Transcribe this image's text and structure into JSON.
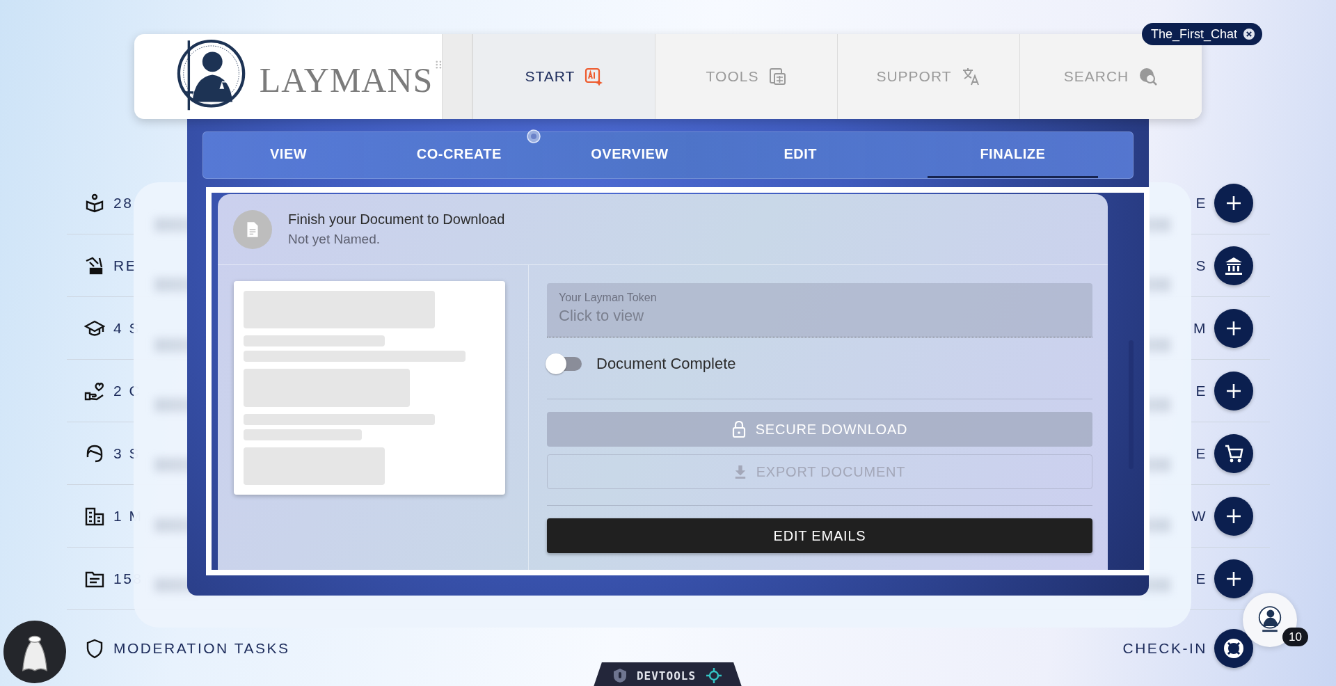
{
  "header": {
    "logo_text": "LAYMANS",
    "tabs": [
      {
        "label": "START",
        "selected": true
      },
      {
        "label": "TOOLS",
        "selected": false
      },
      {
        "label": "SUPPORT",
        "selected": false
      },
      {
        "label": "SEARCH",
        "selected": false
      }
    ]
  },
  "chat_chip": {
    "label": "The_First_Chat"
  },
  "list": {
    "rows": [
      {
        "label": "28",
        "right_text": "E"
      },
      {
        "label": "RE",
        "right_text": "S"
      },
      {
        "label": "4 S",
        "right_text": "M"
      },
      {
        "label": "2 C",
        "right_text": "E"
      },
      {
        "label": "3 S",
        "right_text": "E"
      },
      {
        "label": "1 M",
        "right_text": "W"
      },
      {
        "label": "158",
        "right_text": "E"
      }
    ]
  },
  "footer_row": {
    "label": "MODERATION TASKS",
    "action_label": "CHECK-IN"
  },
  "modal": {
    "tabs": [
      {
        "label": "VIEW",
        "selected": false
      },
      {
        "label": "CO-CREATE",
        "selected": false
      },
      {
        "label": "OVERVIEW",
        "selected": false
      },
      {
        "label": "EDIT",
        "selected": false
      },
      {
        "label": "FINALIZE",
        "selected": true
      }
    ],
    "card": {
      "title": "Finish your Document to Download",
      "subtitle": "Not yet Named.",
      "token_field": {
        "label": "Your Layman Token",
        "placeholder": "Click to view"
      },
      "toggle": {
        "label": "Document Complete",
        "on": false
      },
      "download_buttons": [
        {
          "label": "SECURE DOWNLOAD",
          "kind": "filled",
          "disabled": true
        },
        {
          "label": "EXPORT DOCUMENT",
          "kind": "outlined",
          "disabled": true
        }
      ],
      "email_button": {
        "label": "EDIT EMAILS",
        "kind": "filled",
        "disabled": false
      }
    }
  },
  "notification_badge": "10",
  "devtools": {
    "label": "DEVTOOLS"
  }
}
